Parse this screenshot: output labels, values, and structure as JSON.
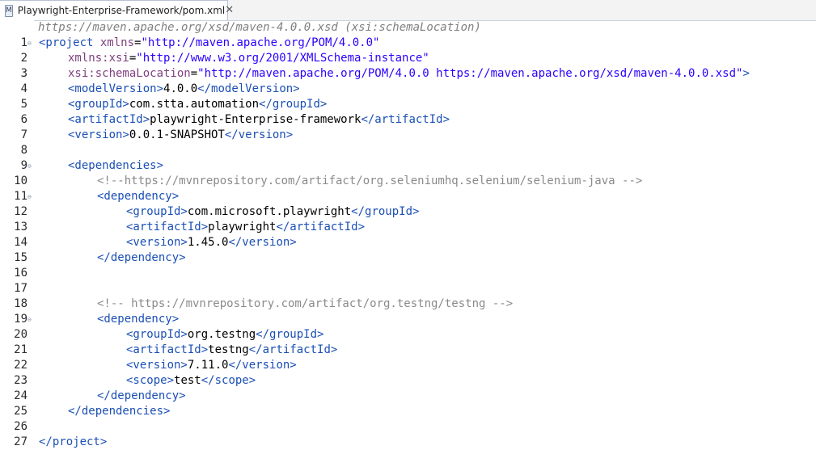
{
  "tab": {
    "icon_letter": "M",
    "title": "Playwright-Enterprise-Framework/pom.xml",
    "close_glyph": "✕"
  },
  "editor": {
    "scroll_remnant": "https://maven.apache.org/xsd/maven-4.0.0.xsd (xsi:schemaLocation)",
    "lines": [
      {
        "n": "1",
        "fold": true,
        "indent": 0,
        "tokens": [
          [
            "tag",
            "<project "
          ],
          [
            "attr",
            "xmlns"
          ],
          [
            "txt",
            "="
          ],
          [
            "val",
            "\"http://maven.apache.org/POM/4.0.0\""
          ]
        ]
      },
      {
        "n": "2",
        "fold": false,
        "indent": 1,
        "tokens": [
          [
            "attr",
            "xmlns:xsi"
          ],
          [
            "txt",
            "="
          ],
          [
            "val",
            "\"http://www.w3.org/2001/XMLSchema-instance\""
          ]
        ]
      },
      {
        "n": "3",
        "fold": false,
        "indent": 1,
        "tokens": [
          [
            "attr",
            "xsi:schemaLocation"
          ],
          [
            "txt",
            "="
          ],
          [
            "val",
            "\"http://maven.apache.org/POM/4.0.0 https://maven.apache.org/xsd/maven-4.0.0.xsd\""
          ],
          [
            "tag",
            ">"
          ]
        ]
      },
      {
        "n": "4",
        "fold": false,
        "indent": 1,
        "tokens": [
          [
            "tag",
            "<modelVersion>"
          ],
          [
            "txt",
            "4.0.0"
          ],
          [
            "tag",
            "</modelVersion>"
          ]
        ]
      },
      {
        "n": "5",
        "fold": false,
        "indent": 1,
        "tokens": [
          [
            "tag",
            "<groupId>"
          ],
          [
            "txt",
            "com.stta.automation"
          ],
          [
            "tag",
            "</groupId>"
          ]
        ]
      },
      {
        "n": "6",
        "fold": false,
        "indent": 1,
        "tokens": [
          [
            "tag",
            "<artifactId>"
          ],
          [
            "txt",
            "playwright-Enterprise-framework"
          ],
          [
            "tag",
            "</artifactId>"
          ]
        ]
      },
      {
        "n": "7",
        "fold": false,
        "indent": 1,
        "tokens": [
          [
            "tag",
            "<version>"
          ],
          [
            "txt",
            "0.0.1-SNAPSHOT"
          ],
          [
            "tag",
            "</version>"
          ]
        ]
      },
      {
        "n": "8",
        "fold": false,
        "indent": 0,
        "tokens": []
      },
      {
        "n": "9",
        "fold": true,
        "indent": 1,
        "tokens": [
          [
            "tag",
            "<dependencies>"
          ]
        ]
      },
      {
        "n": "10",
        "fold": false,
        "indent": 2,
        "tokens": [
          [
            "cmt",
            "<!--https://mvnrepository.com/artifact/org.seleniumhq.selenium/selenium-java -->"
          ]
        ]
      },
      {
        "n": "11",
        "fold": true,
        "indent": 2,
        "tokens": [
          [
            "tag",
            "<dependency>"
          ]
        ]
      },
      {
        "n": "12",
        "fold": false,
        "indent": 3,
        "tokens": [
          [
            "tag",
            "<groupId>"
          ],
          [
            "txt",
            "com.microsoft.playwright"
          ],
          [
            "tag",
            "</groupId>"
          ]
        ]
      },
      {
        "n": "13",
        "fold": false,
        "indent": 3,
        "tokens": [
          [
            "tag",
            "<artifactId>"
          ],
          [
            "txt",
            "playwright"
          ],
          [
            "tag",
            "</artifactId>"
          ]
        ]
      },
      {
        "n": "14",
        "fold": false,
        "indent": 3,
        "tokens": [
          [
            "tag",
            "<version>"
          ],
          [
            "txt",
            "1.45.0"
          ],
          [
            "tag",
            "</version>"
          ]
        ]
      },
      {
        "n": "15",
        "fold": false,
        "indent": 2,
        "tokens": [
          [
            "tag",
            "</dependency>"
          ]
        ]
      },
      {
        "n": "16",
        "fold": false,
        "indent": 0,
        "tokens": []
      },
      {
        "n": "17",
        "fold": false,
        "indent": 0,
        "tokens": []
      },
      {
        "n": "18",
        "fold": false,
        "indent": 2,
        "tokens": [
          [
            "cmt",
            "<!-- https://mvnrepository.com/artifact/org.testng/testng -->"
          ]
        ]
      },
      {
        "n": "19",
        "fold": true,
        "indent": 2,
        "tokens": [
          [
            "tag",
            "<dependency>"
          ]
        ]
      },
      {
        "n": "20",
        "fold": false,
        "indent": 3,
        "tokens": [
          [
            "tag",
            "<groupId>"
          ],
          [
            "txt",
            "org.testng"
          ],
          [
            "tag",
            "</groupId>"
          ]
        ]
      },
      {
        "n": "21",
        "fold": false,
        "indent": 3,
        "tokens": [
          [
            "tag",
            "<artifactId>"
          ],
          [
            "txt",
            "testng"
          ],
          [
            "tag",
            "</artifactId>"
          ]
        ]
      },
      {
        "n": "22",
        "fold": false,
        "indent": 3,
        "tokens": [
          [
            "tag",
            "<version>"
          ],
          [
            "txt",
            "7.11.0"
          ],
          [
            "tag",
            "</version>"
          ]
        ]
      },
      {
        "n": "23",
        "fold": false,
        "indent": 3,
        "tokens": [
          [
            "tag",
            "<scope>"
          ],
          [
            "txt",
            "test"
          ],
          [
            "tag",
            "</scope>"
          ]
        ]
      },
      {
        "n": "24",
        "fold": false,
        "indent": 2,
        "tokens": [
          [
            "tag",
            "</dependency>"
          ]
        ]
      },
      {
        "n": "25",
        "fold": false,
        "indent": 1,
        "tokens": [
          [
            "tag",
            "</dependencies>"
          ]
        ]
      },
      {
        "n": "26",
        "fold": false,
        "indent": 0,
        "tokens": []
      },
      {
        "n": "27",
        "fold": false,
        "indent": 0,
        "tokens": [
          [
            "tag",
            "</project>"
          ]
        ]
      }
    ]
  },
  "colors": {
    "tag": "#1a4fb5",
    "text": "#000000",
    "attribute": "#7f3f7f",
    "value": "#2a00ff",
    "comment": "#8a8a8a"
  }
}
